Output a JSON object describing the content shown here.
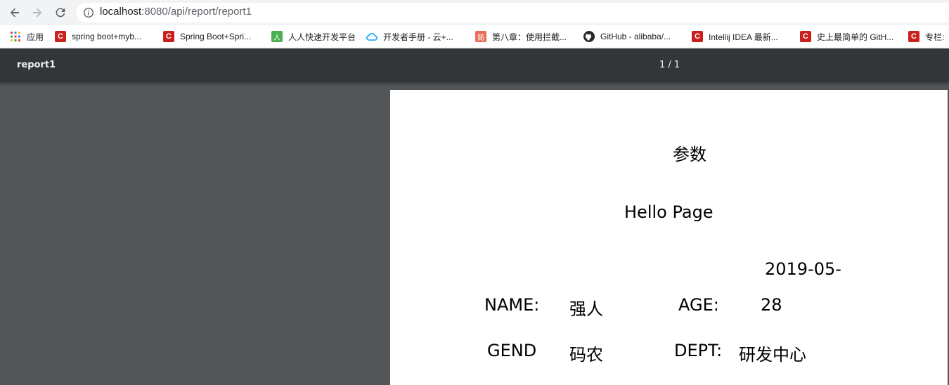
{
  "browser": {
    "url_host": "localhost",
    "url_rest": ":8080/api/report/report1",
    "icons": {
      "back": "back-arrow-icon",
      "forward": "forward-arrow-icon",
      "reload": "reload-icon",
      "info": "info-icon"
    }
  },
  "bookmarks": {
    "apps_label": "应用",
    "items": [
      {
        "label": "spring boot+myb...",
        "icon": "csdn-icon"
      },
      {
        "label": "Spring Boot+Spri...",
        "icon": "csdn-icon"
      },
      {
        "label": "人人快速开发平台",
        "icon": "renren-icon"
      },
      {
        "label": "开发者手册 - 云+...",
        "icon": "cloud-icon"
      },
      {
        "label": "第八章：使用拦截...",
        "icon": "jianshu-icon"
      },
      {
        "label": "GitHub - alibaba/...",
        "icon": "github-icon"
      },
      {
        "label": "Intellij IDEA 最新...",
        "icon": "csdn-icon"
      },
      {
        "label": "史上最简单的 GitH...",
        "icon": "csdn-icon"
      },
      {
        "label": "专栏:",
        "icon": "csdn-icon"
      }
    ],
    "icon_glyphs": {
      "renren": "人",
      "jianshu": "简",
      "csdn": "C"
    }
  },
  "pdf_viewer": {
    "title": "report1",
    "page_count": "1 / 1"
  },
  "report": {
    "params_title": "参数",
    "heading": "Hello Page",
    "date": "2019-05-",
    "fields": {
      "name_label": "NAME:",
      "name_value": "强人",
      "age_label": "AGE:",
      "age_value": "28",
      "gender_label": "GEND",
      "gender_value": "码农",
      "dept_label": "DEPT:",
      "dept_value": "研发中心"
    }
  },
  "colors": {
    "toolbar_bg": "#f1f3f4",
    "pdf_toolbar_bg": "#323639",
    "viewer_bg": "#525659",
    "csdn_red": "#c9211e"
  }
}
